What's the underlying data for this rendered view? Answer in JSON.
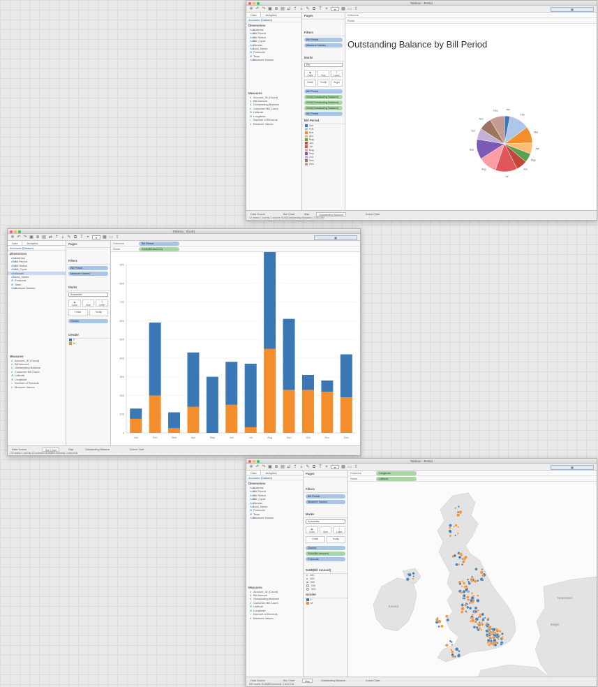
{
  "palette": {
    "tableau_blue": "#3a78b5",
    "tableau_orange": "#f28e2b",
    "pie": [
      "#3a78b5",
      "#aec7e8",
      "#f28e2b",
      "#ffbb78",
      "#59a14f",
      "#c4463a",
      "#e15759",
      "#ff9da7",
      "#7c59b3",
      "#c5b0d5",
      "#9c755f",
      "#c49c94"
    ]
  },
  "win1": {
    "title": "Tableau - Book1",
    "tabs": [
      "Data",
      "Analytics"
    ],
    "source": "Accounts (Dataset)",
    "dims_header": "Dimensions",
    "dimensions": [
      "Address",
      "Bill Period",
      "Bill Status",
      "Bill_Cycle",
      "Gender",
      "Last_Name",
      "Postcode",
      "Town",
      "Measure Names"
    ],
    "meas_header": "Measures",
    "measures": [
      "Account_ID (Count)",
      "Bill Amount",
      "Outstanding Balance",
      "Customer Bill Count",
      "Latitude",
      "Longitude",
      "Number of Records",
      "Measure Values"
    ],
    "pages_label": "Pages",
    "filters_label": "Filters",
    "filters": [
      "Bill Period",
      "Measure Names"
    ],
    "marks_label": "Marks",
    "mark_type": "Pie",
    "mark_buttons": [
      "Color",
      "Size",
      "Label"
    ],
    "mark_buttons2": [
      "Detail",
      "Tooltip",
      "Angle"
    ],
    "marks_pills": [
      "Bill Period",
      "SUM(Outstanding Balance)",
      "SUM(Outstanding Balance)",
      "SUM(Outstanding Balance)",
      "Bill Period"
    ],
    "columns_label": "Columns",
    "rows_label": "Rows",
    "sheet_title": "Outstanding Balance by Bill Period",
    "legend_title": "Bill Period",
    "legend_items": [
      "Jan",
      "Feb",
      "Mar",
      "Apr",
      "May",
      "Jun",
      "Jul",
      "Aug",
      "Sep",
      "Oct",
      "Nov",
      "Dec"
    ],
    "sheet_tabs": [
      "Data Source",
      "Bar Chart",
      "Map",
      "Outstanding Balance",
      "Donut Chart"
    ],
    "active_tab": "Outstanding Balance",
    "status": "12 marks   1 row by 1 column   SUM(Outstanding Balance): 2,330,450"
  },
  "win2": {
    "title": "Tableau - Book1",
    "tabs": [
      "Data",
      "Analytics"
    ],
    "source": "Accounts (Dataset)",
    "dims_header": "Dimensions",
    "dimensions": [
      "Address",
      "Bill Period",
      "Bill Status",
      "Bill_Cycle",
      "Gender",
      "Last_Name",
      "Postcode",
      "Town",
      "Measure Names"
    ],
    "meas_header": "Measures",
    "measures": [
      "Account_ID (Count)",
      "Bill Amount",
      "Outstanding Balance",
      "Customer Bill Count",
      "Latitude",
      "Longitude",
      "Number of Records",
      "Measure Values"
    ],
    "pages_label": "Pages",
    "filters_label": "Filters",
    "filters": [
      "Bill Period",
      "Measure Names"
    ],
    "marks_label": "Marks",
    "mark_type": "Automatic",
    "mark_buttons": [
      "Color",
      "Size",
      "Label"
    ],
    "mark_buttons2": [
      "Detail",
      "Tooltip"
    ],
    "marks_pills": [
      "Gender"
    ],
    "columns_label": "Columns",
    "rows_label": "Rows",
    "columns_pill": "Bill Period",
    "rows_pill": "SUM(Bill Amount)",
    "legend_title": "Gender",
    "legend_items": [
      "F",
      "M"
    ],
    "sheet_tabs": [
      "Data Source",
      "Bar Chart",
      "Map",
      "Outstanding Balance",
      "Donut Chart"
    ],
    "active_tab": "Bar Chart",
    "status": "24 marks   1 row by 12 columns   SUM(Bill Amount): 2,842,018"
  },
  "win3": {
    "title": "Tableau - Book1",
    "tabs": [
      "Data",
      "Analytics"
    ],
    "source": "Accounts (Dataset)",
    "dims_header": "Dimensions",
    "dimensions": [
      "Address",
      "Bill Period",
      "Bill Status",
      "Bill_Cycle",
      "Gender",
      "Last_Name",
      "Postcode",
      "Town",
      "Measure Names"
    ],
    "meas_header": "Measures",
    "measures": [
      "Account_ID (Count)",
      "Bill Amount",
      "Outstanding Balance",
      "Customer Bill Count",
      "Latitude",
      "Longitude",
      "Number of Records",
      "Measure Values"
    ],
    "pages_label": "Pages",
    "filters_label": "Filters",
    "filters": [
      "Bill Period",
      "Measure Names"
    ],
    "marks_label": "Marks",
    "mark_type": "Automatic",
    "mark_buttons": [
      "Color",
      "Size",
      "Label"
    ],
    "mark_buttons2": [
      "Detail",
      "Tooltip"
    ],
    "marks_pills": [
      "Gender",
      "SUM(Bill Amount)",
      "Postcode"
    ],
    "columns_label": "Columns",
    "rows_label": "Rows",
    "columns_pill": "Longitude",
    "rows_pill": "Latitude",
    "size_title": "SUM(Bill Amount)",
    "size_items": [
      "100",
      "200",
      "300",
      "400",
      "500"
    ],
    "legend_title": "Gender",
    "legend_items": [
      "F",
      "M"
    ],
    "map_labels": [
      "Ireland",
      "Nederland",
      "Belgie"
    ],
    "sheet_tabs": [
      "Data Source",
      "Bar Chart",
      "Map",
      "Outstanding Balance",
      "Donut Chart"
    ],
    "active_tab": "Map",
    "status": "650 marks   SUM(Bill Amount): 2,842,018"
  },
  "chart_data": [
    {
      "type": "pie",
      "title": "Outstanding Balance by Bill Period",
      "categories": [
        "Jan",
        "Feb",
        "Mar",
        "Apr",
        "May",
        "Jun",
        "Jul",
        "Aug",
        "Sep",
        "Oct",
        "Nov",
        "Dec"
      ],
      "values": [
        3,
        11,
        9,
        6,
        5,
        6,
        12,
        10,
        11,
        6,
        7,
        8
      ]
    },
    {
      "type": "bar",
      "stacked": true,
      "xlabel": "",
      "ylabel": "",
      "ylim": [
        0,
        900
      ],
      "categories": [
        "Jan",
        "Feb",
        "Mar",
        "Apr",
        "May",
        "Jun",
        "Jul",
        "Aug",
        "Sep",
        "Oct",
        "Nov",
        "Dec"
      ],
      "series": [
        {
          "name": "F",
          "values": [
            75,
            200,
            25,
            140,
            0,
            150,
            30,
            450,
            230,
            230,
            220,
            190
          ]
        },
        {
          "name": "M",
          "values": [
            55,
            390,
            85,
            290,
            300,
            230,
            340,
            630,
            380,
            80,
            60,
            230
          ]
        }
      ],
      "yticks": [
        0,
        100,
        200,
        300,
        400,
        500,
        600,
        700,
        800,
        900
      ]
    }
  ]
}
